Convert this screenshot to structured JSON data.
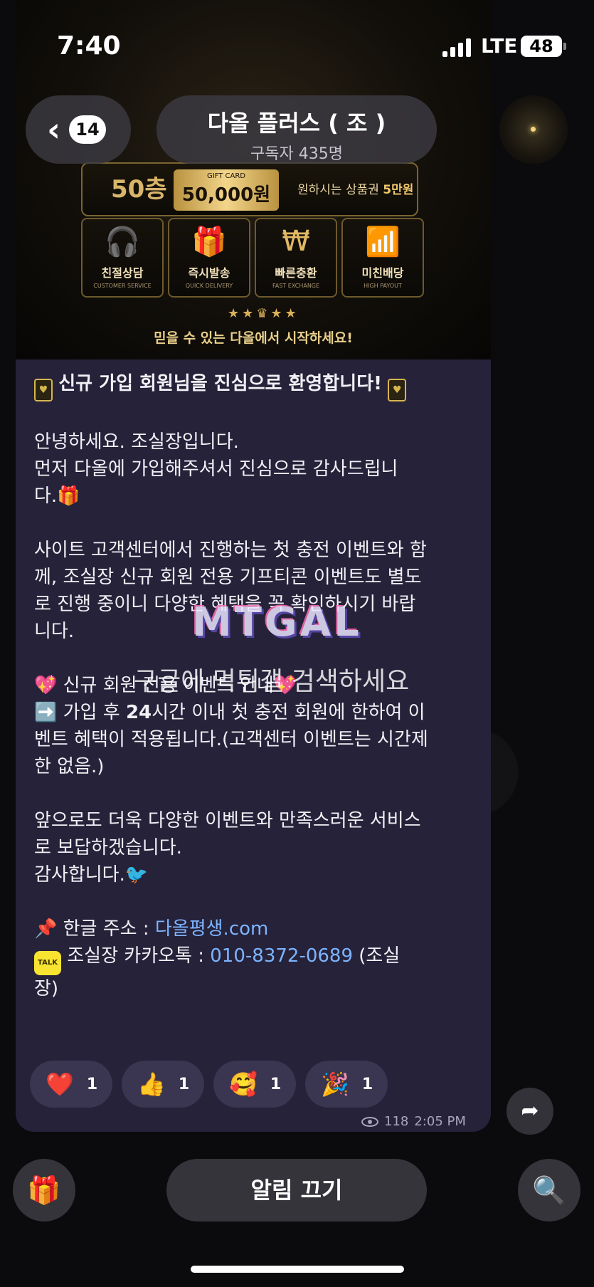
{
  "status_bar": {
    "time": "7:40",
    "network": "LTE",
    "battery": "48"
  },
  "header": {
    "back_count": "14",
    "channel_name": "다올 플러스 ( 조 )",
    "subscribers": "구독자 435명"
  },
  "banner": {
    "floor": "50층",
    "gift_card_title": "GIFT CARD",
    "gift_card_amount": "50,000원",
    "gift_desc_prefix": "원하시는 상품권 ",
    "gift_desc_value": "5만원",
    "features": [
      {
        "icon": "headset-icon",
        "name": "친절상담",
        "sub": "CUSTOMER SERVICE"
      },
      {
        "icon": "gift-icon",
        "name": "즉시발송",
        "sub": "QUICK DELIVERY"
      },
      {
        "icon": "won-exchange-icon",
        "name": "빠른충환",
        "sub": "FAST EXCHANGE"
      },
      {
        "icon": "chart-icon",
        "name": "미친배당",
        "sub": "HIGH PAYOUT"
      }
    ],
    "tagline": "믿을 수 있는 다올에서 시작하세요!"
  },
  "message": {
    "headline": "신규 가입 회원님을 진심으로 환영합니다!",
    "greeting1": "안녕하세요. 조실장입니다.",
    "greeting2": "먼저 다올에 가입해주셔서 진심으로 감사드립니\n다.",
    "paragraph2": "사이트 고객센터에서 진행하는 첫 충전 이벤트와 함\n께, 조실장 신규 회원 전용 기프티콘 이벤트도 별도\n로 진행 중이니 다양한 혜택을 꼭 확인하시기 바랍\n니다.",
    "event_title": "신규 회원 전용 이벤트 안내",
    "event_pre": " 가입 후 ",
    "event_bold": "24",
    "event_post": "시간 이내 첫 충전 회원에 한하여 이\n벤트 혜택이 적용됩니다.(고객센터 이벤트는 시간제\n한 없음.)",
    "closing1": "앞으로도 더욱 다양한 이벤트와 만족스러운 서비스\n로 보답하겠습니다.",
    "closing2": "감사합니다.",
    "address_label": "한글 주소 : ",
    "address_link": "다올평생.com",
    "kakao_label": "조실장 카카오톡 : ",
    "kakao_number": "010-8372-0689",
    "kakao_suffix": " (조실\n장)"
  },
  "reactions": [
    {
      "emoji": "❤️",
      "count": "1"
    },
    {
      "emoji": "👍",
      "count": "1"
    },
    {
      "emoji": "🥰",
      "count": "1"
    },
    {
      "emoji": "🎉",
      "count": "1"
    }
  ],
  "meta": {
    "views": "118",
    "time": "2:05 PM"
  },
  "watermark": {
    "logo": "MTGAL",
    "text": "구글에 먹튀갤 검색하세요"
  },
  "bottom": {
    "mute_label": "알림 끄기"
  }
}
